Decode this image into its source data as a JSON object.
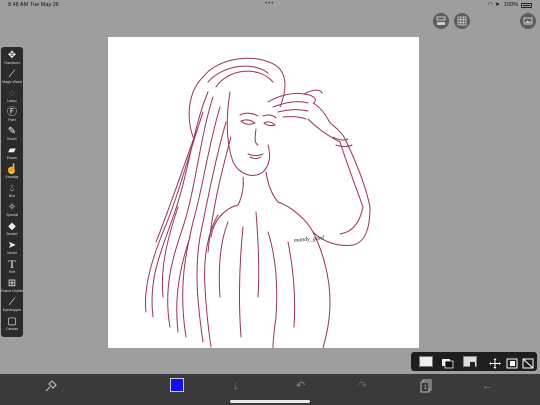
{
  "status_bar": {
    "time": "8:48 AM",
    "date": "Tue May 26",
    "battery": "100%"
  },
  "colors": {
    "accent": "#5aa0ff",
    "current_color": "#1010ee",
    "stroke": "#8c1c4e"
  },
  "tools": [
    {
      "label": "Transform",
      "icon": "move-icon"
    },
    {
      "label": "Magic Wand",
      "icon": "magic-wand-icon"
    },
    {
      "label": "Lasso",
      "icon": "lasso-icon",
      "active": true
    },
    {
      "label": "Filter",
      "icon": "filter-icon"
    },
    {
      "label": "Brush",
      "icon": "brush-icon"
    },
    {
      "label": "Eraser",
      "icon": "eraser-icon"
    },
    {
      "label": "Smudge",
      "icon": "smudge-icon"
    },
    {
      "label": "Blur",
      "icon": "blur-icon"
    },
    {
      "label": "Special",
      "icon": "special-icon"
    },
    {
      "label": "Bucket",
      "icon": "bucket-icon"
    },
    {
      "label": "Vector",
      "icon": "vector-icon"
    },
    {
      "label": "Text",
      "icon": "text-icon"
    },
    {
      "label": "Frame Divider",
      "icon": "frame-divider-icon"
    },
    {
      "label": "Eyedropper",
      "icon": "eyedropper-icon"
    },
    {
      "label": "Canvas",
      "icon": "canvas-icon"
    }
  ],
  "signature": "mandy_gard"
}
